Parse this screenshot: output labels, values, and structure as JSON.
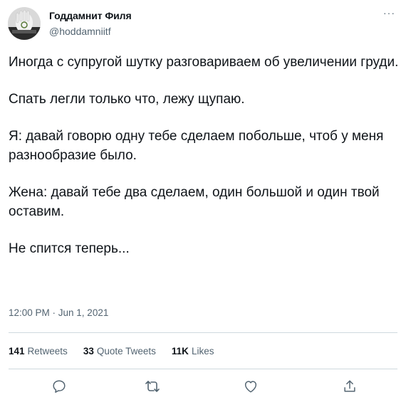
{
  "author": {
    "name": "Годдамнит Филя",
    "handle": "@hoddamniitf"
  },
  "more_label": "···",
  "tweet": {
    "paragraphs": [
      "Иногда с супругой шутку разговариваем об увеличении груди.",
      "Спать легли только что, лежу щупаю.",
      "Я: давай говорю одну тебе сделаем побольше, чтоб у меня разнообразие было.",
      "Жена: давай тебе два сделаем, один большой и один твой оставим.",
      "Не спится теперь..."
    ],
    "timestamp": "12:00 PM · Jun 1, 2021"
  },
  "stats": {
    "retweets_count": "141",
    "retweets_label": "Retweets",
    "quotes_count": "33",
    "quotes_label": "Quote Tweets",
    "likes_count": "11K",
    "likes_label": "Likes"
  },
  "actions": {
    "reply_icon": "reply-icon",
    "retweet_icon": "retweet-icon",
    "like_icon": "heart-icon",
    "share_icon": "share-icon"
  },
  "colors": {
    "text_primary": "#0f1419",
    "text_secondary": "#536471",
    "divider": "#cfd9de"
  }
}
